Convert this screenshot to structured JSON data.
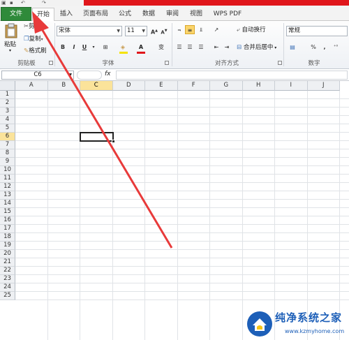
{
  "tabs": {
    "file": "文件",
    "items": [
      "开始",
      "插入",
      "页面布局",
      "公式",
      "数据",
      "审阅",
      "视图",
      "WPS PDF"
    ],
    "active_index": 0
  },
  "ribbon": {
    "clipboard": {
      "paste": "粘贴",
      "cut": "剪切",
      "copy": "复制",
      "format_painter": "格式刷",
      "group_label": "剪贴板"
    },
    "font": {
      "font_name": "宋体",
      "font_size": "11",
      "group_label": "字体",
      "bold": "B",
      "italic": "I",
      "underline": "U",
      "grow": "A",
      "shrink": "A",
      "color_a": "A",
      "wen": "变"
    },
    "alignment": {
      "wrap_text": "自动换行",
      "merge_center": "合并后居中",
      "group_label": "对齐方式"
    },
    "number": {
      "format": "常规",
      "group_label": "数字",
      "percent": "%",
      "comma": ","
    }
  },
  "formula_bar": {
    "name_box": "C6",
    "fx": "fx",
    "value": ""
  },
  "sheet": {
    "columns": [
      "A",
      "B",
      "C",
      "D",
      "E",
      "F",
      "G",
      "H",
      "I",
      "J"
    ],
    "rows": [
      "1",
      "2",
      "3",
      "4",
      "5",
      "6",
      "7",
      "8",
      "9",
      "10",
      "11",
      "12",
      "13",
      "14",
      "15",
      "16",
      "17",
      "18",
      "19",
      "20",
      "21",
      "22",
      "23",
      "24",
      "25"
    ],
    "selected_column": "C",
    "selected_row": "6"
  },
  "watermark": {
    "title": "纯净系统之家",
    "url": "www.kzmyhome.com"
  },
  "colors": {
    "title_red": "#e0161b",
    "file_tab_green": "#2f8a3a",
    "selection_header": "#fbe39a",
    "arrow_red": "#e83a3a",
    "watermark_blue": "#1d5fb8"
  }
}
